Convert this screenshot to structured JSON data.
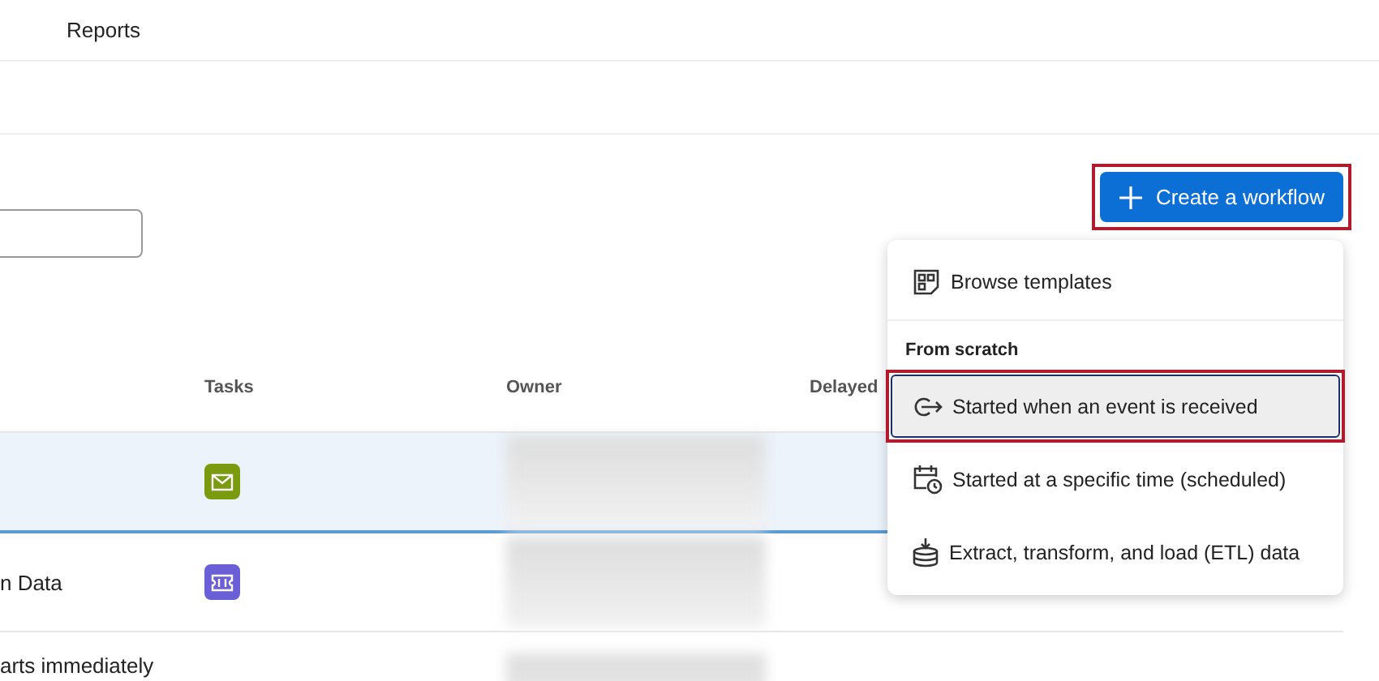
{
  "nav": {
    "items": [
      {
        "label": "Reports"
      }
    ]
  },
  "create_button": {
    "label": "Create a workflow",
    "highlighted": true
  },
  "menu": {
    "items": [
      {
        "kind": "option",
        "label": "Browse templates",
        "highlighted": false
      },
      {
        "kind": "heading",
        "label": "From scratch"
      },
      {
        "kind": "option",
        "label": "Started when an event is received",
        "highlighted": true
      },
      {
        "kind": "option",
        "label": "Started at a specific time (scheduled)",
        "highlighted": false
      },
      {
        "kind": "option",
        "label": "Extract, transform, and load (ETL) data",
        "highlighted": false
      }
    ]
  },
  "table": {
    "columns": [
      "",
      "Tasks",
      "Owner",
      "Delayed"
    ],
    "rows": [
      {
        "name": "",
        "kind": "email",
        "selected": true
      },
      {
        "name": "n Data",
        "kind": "ticket",
        "selected": false
      },
      {
        "name": "arts immediately",
        "kind": "none",
        "selected": false
      }
    ]
  }
}
